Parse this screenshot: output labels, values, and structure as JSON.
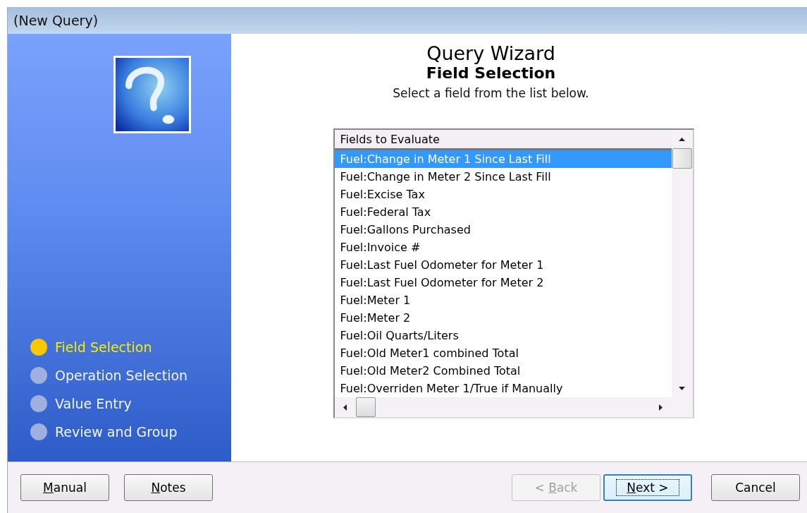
{
  "window": {
    "title": "(New Query)"
  },
  "steps": [
    {
      "label": "Field Selection",
      "selected": true
    },
    {
      "label": "Operation Selection",
      "selected": false
    },
    {
      "label": "Value Entry",
      "selected": false
    },
    {
      "label": "Review and Group",
      "selected": false
    }
  ],
  "heading": {
    "title": "Query Wizard",
    "subtitle": "Field Selection",
    "instruction": "Select a field from the list below."
  },
  "list": {
    "header": "Fields to Evaluate",
    "items": [
      {
        "label": "Fuel:Change in Meter 1 Since Last Fill",
        "selected": true
      },
      {
        "label": "Fuel:Change in Meter 2 Since Last Fill",
        "selected": false
      },
      {
        "label": "Fuel:Excise Tax",
        "selected": false
      },
      {
        "label": "Fuel:Federal Tax",
        "selected": false
      },
      {
        "label": "Fuel:Gallons Purchased",
        "selected": false
      },
      {
        "label": "Fuel:Invoice #",
        "selected": false
      },
      {
        "label": "Fuel:Last Fuel Odometer for Meter 1",
        "selected": false
      },
      {
        "label": "Fuel:Last Fuel Odometer for Meter 2",
        "selected": false
      },
      {
        "label": "Fuel:Meter 1",
        "selected": false
      },
      {
        "label": "Fuel:Meter 2",
        "selected": false
      },
      {
        "label": "Fuel:Oil Quarts/Liters",
        "selected": false
      },
      {
        "label": "Fuel:Old Meter1  combined Total",
        "selected": false
      },
      {
        "label": "Fuel:Old Meter2  Combined Total",
        "selected": false
      },
      {
        "label": "Fuel:Overriden Meter 1/True if Manually",
        "selected": false
      }
    ]
  },
  "buttons_left": [
    {
      "key": "M",
      "post": "anual",
      "disabled": false,
      "focused": false
    },
    {
      "key": "N",
      "post": "otes",
      "disabled": false,
      "focused": false
    }
  ],
  "buttons_right": [
    {
      "pre": "< ",
      "key": "B",
      "post": "ack",
      "disabled": true,
      "focused": false
    },
    {
      "key": "N",
      "post": "ext >",
      "disabled": false,
      "focused": true
    },
    {
      "pre": "Cancel",
      "disabled": false,
      "focused": false
    }
  ]
}
